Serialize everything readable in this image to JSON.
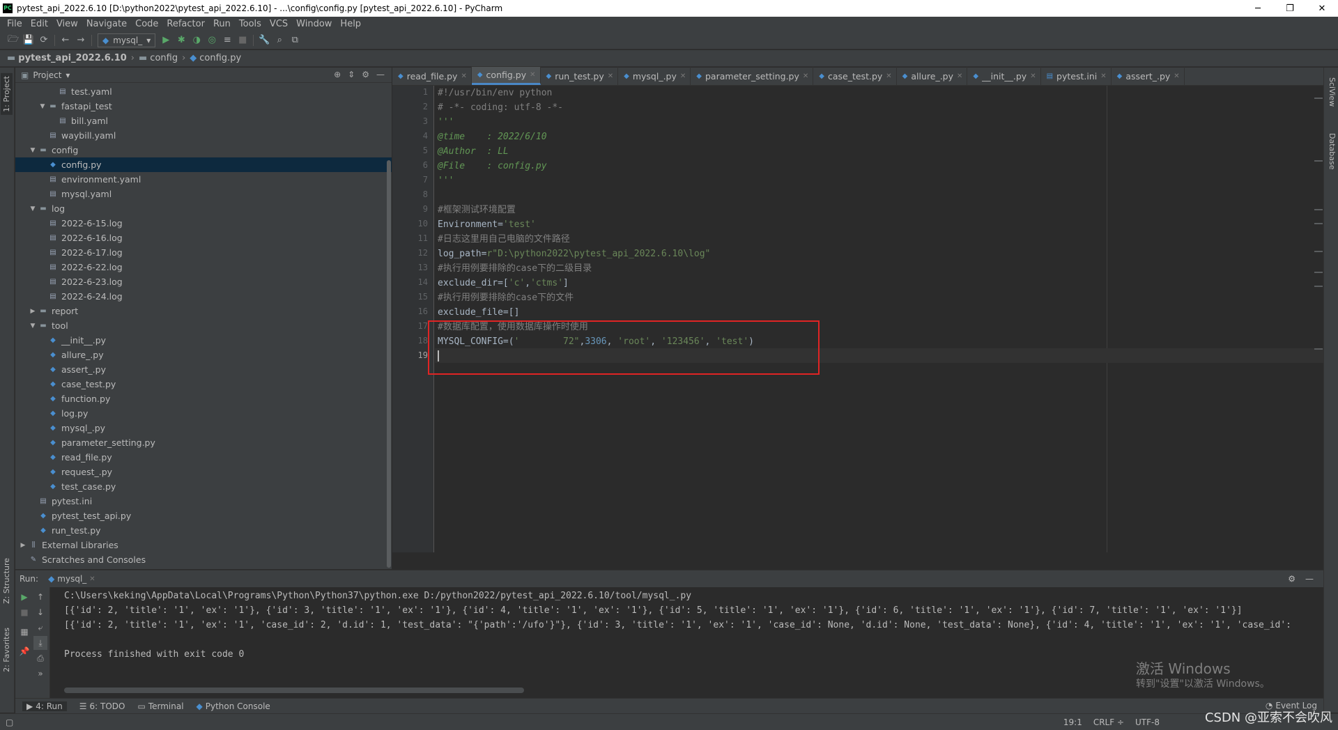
{
  "window": {
    "title": "pytest_api_2022.6.10 [D:\\python2022\\pytest_api_2022.6.10] - ...\\config\\config.py [pytest_api_2022.6.10] - PyCharm",
    "app_icon": "PC",
    "minimize": "─",
    "maximize": "❐",
    "close": "✕"
  },
  "menu": [
    "File",
    "Edit",
    "View",
    "Navigate",
    "Code",
    "Refactor",
    "Run",
    "Tools",
    "VCS",
    "Window",
    "Help"
  ],
  "toolbar": {
    "run_config": "mysql_"
  },
  "breadcrumb": [
    "pytest_api_2022.6.10",
    "config",
    "config.py"
  ],
  "left_strip": {
    "project": "1: Project",
    "structure": "Z: Structure",
    "favorites": "2: Favorites"
  },
  "right_strip": {
    "sciview": "SciView",
    "database": "Database"
  },
  "project_panel": {
    "title": "Project",
    "tree": [
      {
        "label": "test.yaml",
        "type": "yaml",
        "depth": 4,
        "arrow": ""
      },
      {
        "label": "fastapi_test",
        "type": "folder",
        "depth": 3,
        "arrow": "▼"
      },
      {
        "label": "bill.yaml",
        "type": "yaml",
        "depth": 4,
        "arrow": ""
      },
      {
        "label": "waybill.yaml",
        "type": "yaml",
        "depth": 3,
        "arrow": ""
      },
      {
        "label": "config",
        "type": "folder",
        "depth": 2,
        "arrow": "▼"
      },
      {
        "label": "config.py",
        "type": "py",
        "depth": 3,
        "arrow": "",
        "selected": true
      },
      {
        "label": "environment.yaml",
        "type": "yaml",
        "depth": 3,
        "arrow": ""
      },
      {
        "label": "mysql.yaml",
        "type": "yaml",
        "depth": 3,
        "arrow": ""
      },
      {
        "label": "log",
        "type": "folder",
        "depth": 2,
        "arrow": "▼"
      },
      {
        "label": "2022-6-15.log",
        "type": "log",
        "depth": 3,
        "arrow": ""
      },
      {
        "label": "2022-6-16.log",
        "type": "log",
        "depth": 3,
        "arrow": ""
      },
      {
        "label": "2022-6-17.log",
        "type": "log",
        "depth": 3,
        "arrow": ""
      },
      {
        "label": "2022-6-22.log",
        "type": "log",
        "depth": 3,
        "arrow": ""
      },
      {
        "label": "2022-6-23.log",
        "type": "log",
        "depth": 3,
        "arrow": ""
      },
      {
        "label": "2022-6-24.log",
        "type": "log",
        "depth": 3,
        "arrow": ""
      },
      {
        "label": "report",
        "type": "folder",
        "depth": 2,
        "arrow": "▶"
      },
      {
        "label": "tool",
        "type": "folder",
        "depth": 2,
        "arrow": "▼"
      },
      {
        "label": "__init__.py",
        "type": "py",
        "depth": 3,
        "arrow": ""
      },
      {
        "label": "allure_.py",
        "type": "py",
        "depth": 3,
        "arrow": ""
      },
      {
        "label": "assert_.py",
        "type": "py",
        "depth": 3,
        "arrow": ""
      },
      {
        "label": "case_test.py",
        "type": "py",
        "depth": 3,
        "arrow": ""
      },
      {
        "label": "function.py",
        "type": "py",
        "depth": 3,
        "arrow": ""
      },
      {
        "label": "log.py",
        "type": "py",
        "depth": 3,
        "arrow": ""
      },
      {
        "label": "mysql_.py",
        "type": "py",
        "depth": 3,
        "arrow": ""
      },
      {
        "label": "parameter_setting.py",
        "type": "py",
        "depth": 3,
        "arrow": ""
      },
      {
        "label": "read_file.py",
        "type": "py",
        "depth": 3,
        "arrow": ""
      },
      {
        "label": "request_.py",
        "type": "py",
        "depth": 3,
        "arrow": ""
      },
      {
        "label": "test_case.py",
        "type": "py",
        "depth": 3,
        "arrow": ""
      },
      {
        "label": "pytest.ini",
        "type": "ini",
        "depth": 2,
        "arrow": ""
      },
      {
        "label": "pytest_test_api.py",
        "type": "py",
        "depth": 2,
        "arrow": ""
      },
      {
        "label": "run_test.py",
        "type": "py",
        "depth": 2,
        "arrow": ""
      },
      {
        "label": "External Libraries",
        "type": "lib",
        "depth": 1,
        "arrow": "▶"
      },
      {
        "label": "Scratches and Consoles",
        "type": "scratch",
        "depth": 1,
        "arrow": ""
      }
    ]
  },
  "editor_tabs": [
    {
      "label": "read_file.py",
      "active": false
    },
    {
      "label": "config.py",
      "active": true
    },
    {
      "label": "run_test.py",
      "active": false
    },
    {
      "label": "mysql_.py",
      "active": false
    },
    {
      "label": "parameter_setting.py",
      "active": false
    },
    {
      "label": "case_test.py",
      "active": false
    },
    {
      "label": "allure_.py",
      "active": false
    },
    {
      "label": "__init__.py",
      "active": false
    },
    {
      "label": "pytest.ini",
      "active": false
    },
    {
      "label": "assert_.py",
      "active": false
    }
  ],
  "code_lines": [
    [
      {
        "t": "#!/usr/bin/env python",
        "c": "cm"
      }
    ],
    [
      {
        "t": "# -*- coding: utf-8 -*-",
        "c": "cm"
      }
    ],
    [
      {
        "t": "'''",
        "c": "doc"
      }
    ],
    [
      {
        "t": "@time    : 2022/6/10",
        "c": "doc"
      }
    ],
    [
      {
        "t": "@Author  : LL",
        "c": "doc"
      }
    ],
    [
      {
        "t": "@File    : config.py",
        "c": "doc"
      }
    ],
    [
      {
        "t": "'''",
        "c": "doc"
      }
    ],
    [
      {
        "t": "",
        "c": ""
      }
    ],
    [
      {
        "t": "#框架测试环境配置",
        "c": "cm"
      }
    ],
    [
      {
        "t": "Environment=",
        "c": ""
      },
      {
        "t": "'test'",
        "c": "str"
      }
    ],
    [
      {
        "t": "#日志这里用自己电脑的文件路径",
        "c": "cm"
      }
    ],
    [
      {
        "t": "log_path=",
        "c": ""
      },
      {
        "t": "r\"D:\\python2022\\pytest_api_2022.6.10\\log\"",
        "c": "str"
      }
    ],
    [
      {
        "t": "#执行用例要排除的case下的二级目录",
        "c": "cm"
      }
    ],
    [
      {
        "t": "exclude_dir=[",
        "c": ""
      },
      {
        "t": "'c'",
        "c": "str"
      },
      {
        "t": ",",
        "c": ""
      },
      {
        "t": "'ctms'",
        "c": "str"
      },
      {
        "t": "]",
        "c": ""
      }
    ],
    [
      {
        "t": "#执行用例要排除的case下的文件",
        "c": "cm"
      }
    ],
    [
      {
        "t": "exclude_file=[]",
        "c": ""
      }
    ],
    [
      {
        "t": "#数据库配置，使用数据库操作时使用",
        "c": "cm"
      }
    ],
    [
      {
        "t": "MYSQL_CONFIG=(",
        "c": ""
      },
      {
        "t": "'        72\"",
        "c": "str"
      },
      {
        "t": ",",
        "c": ""
      },
      {
        "t": "3306",
        "c": "num"
      },
      {
        "t": ", ",
        "c": ""
      },
      {
        "t": "'root'",
        "c": "str"
      },
      {
        "t": ", ",
        "c": ""
      },
      {
        "t": "'123456'",
        "c": "str"
      },
      {
        "t": ", ",
        "c": ""
      },
      {
        "t": "'test'",
        "c": "str"
      },
      {
        "t": ")",
        "c": ""
      }
    ],
    [
      {
        "t": "",
        "c": ""
      }
    ]
  ],
  "run_panel": {
    "label": "Run:",
    "tab": "mysql_",
    "output": [
      "C:\\Users\\keking\\AppData\\Local\\Programs\\Python\\Python37\\python.exe D:/python2022/pytest_api_2022.6.10/tool/mysql_.py",
      "[{'id': 2, 'title': '1', 'ex': '1'}, {'id': 3, 'title': '1', 'ex': '1'}, {'id': 4, 'title': '1', 'ex': '1'}, {'id': 5, 'title': '1', 'ex': '1'}, {'id': 6, 'title': '1', 'ex': '1'}, {'id': 7, 'title': '1', 'ex': '1'}]",
      "[{'id': 2, 'title': '1', 'ex': '1', 'case_id': 2, 'd.id': 1, 'test_data': \"{'path':'/ufo'}\"}, {'id': 3, 'title': '1', 'ex': '1', 'case_id': None, 'd.id': None, 'test_data': None}, {'id': 4, 'title': '1', 'ex': '1', 'case_id':",
      "",
      "Process finished with exit code 0"
    ],
    "watermark_line1": "激活 Windows",
    "watermark_line2": "转到\"设置\"以激活 Windows。"
  },
  "bottom_tabs": [
    "4: Run",
    "6: TODO",
    "Terminal",
    "Python Console"
  ],
  "event_log": "Event Log",
  "status": {
    "position": "19:1",
    "line_sep": "CRLF ÷",
    "encoding": "UTF-8"
  },
  "csdn_watermark": "CSDN @亚索不会吹风"
}
